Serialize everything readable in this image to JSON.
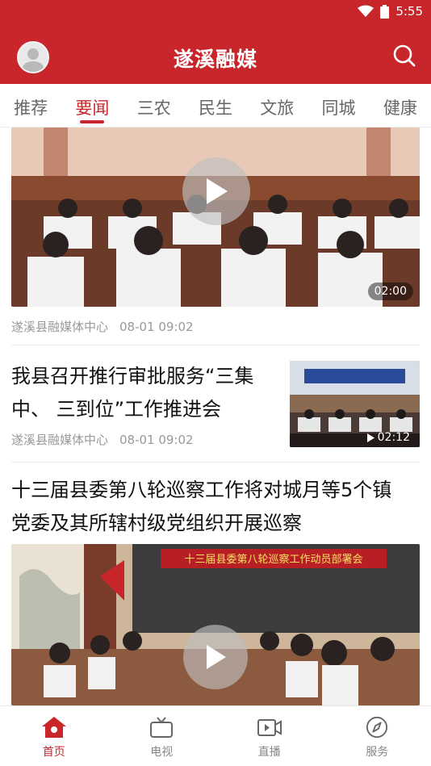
{
  "status_bar": {
    "time": "5:55"
  },
  "header": {
    "title": "遂溪融媒"
  },
  "tabs": [
    {
      "label": "推荐"
    },
    {
      "label": "要闻"
    },
    {
      "label": "三农"
    },
    {
      "label": "民生"
    },
    {
      "label": "文旅"
    },
    {
      "label": "同城"
    },
    {
      "label": "健康"
    }
  ],
  "active_tab": "要闻",
  "feed": {
    "item1": {
      "source": "遂溪县融媒体中心",
      "time": "08-01 09:02",
      "duration": "02:00"
    },
    "item2": {
      "title_line1": "我县召开推行审批服务“三集",
      "title_line2": "中、 三到位”工作推进会",
      "source": "遂溪县融媒体中心",
      "time": "08-01 09:02",
      "duration": "02:12"
    },
    "item3": {
      "title_line1": "十三届县委第八轮巡察工作将对城月等5个镇",
      "title_line2": "党委及其所辖村级党组织开展巡察",
      "banner_text": "十三届县委第八轮巡察工作动员部署会"
    }
  },
  "bottom_nav": [
    {
      "label": "首页",
      "icon": "home-icon"
    },
    {
      "label": "电视",
      "icon": "tv-icon"
    },
    {
      "label": "直播",
      "icon": "live-video-icon"
    },
    {
      "label": "服务",
      "icon": "compass-icon"
    }
  ],
  "colors": {
    "brand_red": "#c8262b",
    "text_gray": "#999999",
    "tab_gray": "#666666"
  }
}
